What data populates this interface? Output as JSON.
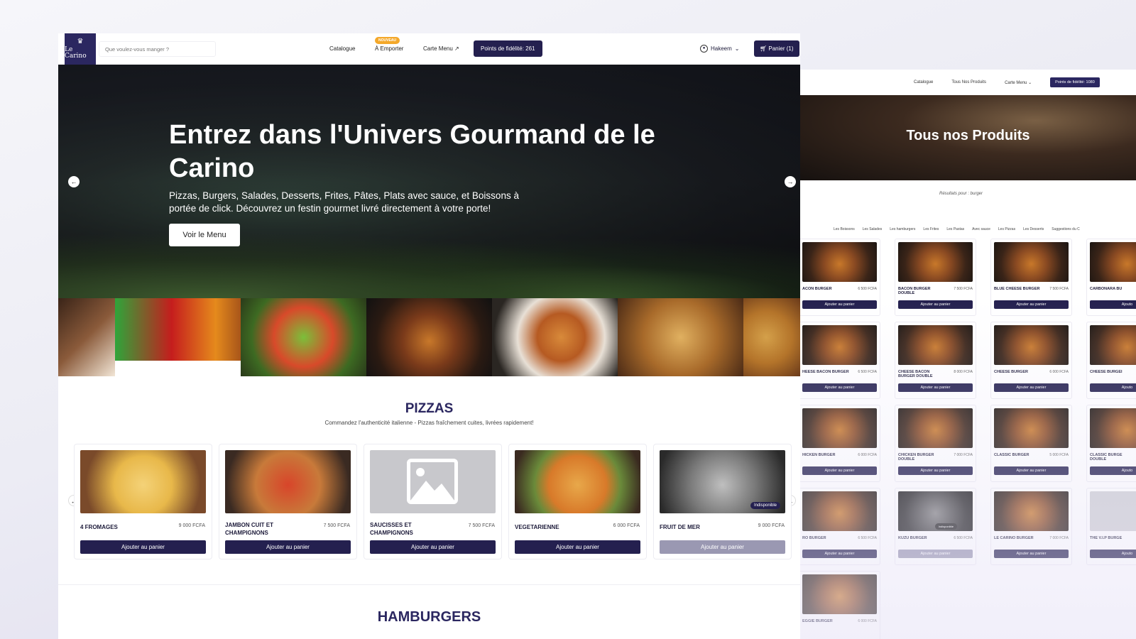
{
  "main": {
    "logo_text": "Le Carino",
    "search": {
      "placeholder": "Que voulez-vous manger ?"
    },
    "nav": {
      "catalogue": "Catalogue",
      "emporter": "À Emporter",
      "emporter_badge": "NOUVEAU",
      "carte_menu": "Carte Menu",
      "points": "Points de fidélité: 261",
      "user": "Hakeem",
      "cart": "Panier (1)"
    },
    "hero": {
      "title": "Entrez dans l'Univers Gourmand de le Carino",
      "subtitle": "Pizzas, Burgers, Salades, Desserts, Frites, Pâtes, Plats avec sauce, et Boissons à portée de click. Découvrez un festin gourmet livré directement à votre porte!",
      "cta": "Voir le Menu"
    },
    "pizzas": {
      "title": "PIZZAS",
      "subtitle": "Commandez l'authenticité italienne - Pizzas fraîchement cuites, livrées rapidement!",
      "items": [
        {
          "name": "4 FROMAGES",
          "price": "9 000 FCFA",
          "button": "Ajouter au panier"
        },
        {
          "name": "JAMBON CUIT ET CHAMPIGNONS",
          "price": "7 500 FCFA",
          "button": "Ajouter au panier"
        },
        {
          "name": "SAUCISSES ET CHAMPIGNONS",
          "price": "7 500 FCFA",
          "button": "Ajouter au panier"
        },
        {
          "name": "VEGETARIENNE",
          "price": "6 000 FCFA",
          "button": "Ajouter au panier"
        },
        {
          "name": "FRUIT DE MER",
          "price": "9 000 FCFA",
          "button": "Ajouter au panier",
          "badge": "Indisponible"
        }
      ]
    },
    "hamburgers_title": "HAMBURGERS"
  },
  "side": {
    "nav": {
      "catalogue": "Catalogue",
      "products": "Tous Nos Produits",
      "carte_menu": "Carte Menu",
      "points": "Points de fidélité: 1080"
    },
    "hero_title": "Tous nos Produits",
    "result_text": "Résultats pour : burger",
    "categories": [
      "Les Boissons",
      "Les Salades",
      "Les hamburgers",
      "Les Frites",
      "Les Pastas",
      "Avec sauce",
      "Les Pizzas",
      "Les Desserts",
      "Suggestions du C"
    ],
    "products": [
      {
        "name": "ACON BURGER",
        "price": "6 500 FCFA",
        "button": "Ajouter au panier"
      },
      {
        "name": "BACON BURGER DOUBLE",
        "price": "7 500 FCFA",
        "button": "Ajouter au panier"
      },
      {
        "name": "BLUE CHEESE BURGER",
        "price": "7 500 FCFA",
        "button": "Ajouter au panier"
      },
      {
        "name": "CARBONARA BU",
        "price": "",
        "button": "Ajouto"
      },
      {
        "name": "HEESE BACON BURGER",
        "price": "6 500 FCFA",
        "button": "Ajouter au panier"
      },
      {
        "name": "CHEESE BACON BURGER DOUBLE",
        "price": "8 000 FCFA",
        "button": "Ajouter au panier"
      },
      {
        "name": "CHEESE BURGER",
        "price": "6 000 FCFA",
        "button": "Ajouter au panier"
      },
      {
        "name": "CHEESE BURGEI",
        "price": "",
        "button": "Ajouto"
      },
      {
        "name": "HICKEN BURGER",
        "price": "6 000 FCFA",
        "button": "Ajouter au panier"
      },
      {
        "name": "CHICKEN BURGER DOUBLE",
        "price": "7 000 FCFA",
        "button": "Ajouter au panier"
      },
      {
        "name": "CLASSIC BURGER",
        "price": "5 000 FCFA",
        "button": "Ajouter au panier"
      },
      {
        "name": "CLASSIC BURGE DOUBLE",
        "price": "",
        "button": "Ajouto"
      },
      {
        "name": "RO BURGER",
        "price": "6 500 FCFA",
        "button": "Ajouter au panier"
      },
      {
        "name": "KUZU BURGER",
        "price": "6 500 FCFA",
        "button": "Ajouter au panier",
        "badge": "Indisponible"
      },
      {
        "name": "LE CARINO BURGER",
        "price": "7 000 FCFA",
        "button": "Ajouter au panier"
      },
      {
        "name": "THE V.I.P BURGE",
        "price": "",
        "button": "Ajouto"
      },
      {
        "name": "EGGIE BURGER",
        "price": "6 000 FCFA",
        "button": ""
      }
    ]
  },
  "colors": {
    "primary": "#24204f",
    "disabled": "#9a98b2",
    "badge_new": "#f4a82a"
  }
}
